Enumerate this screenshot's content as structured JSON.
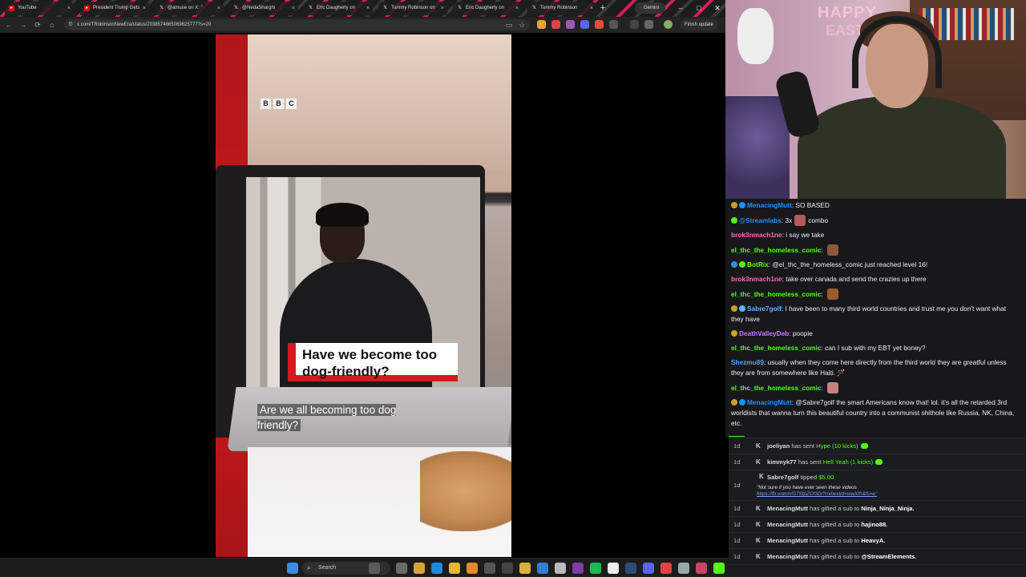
{
  "browser": {
    "tabs": [
      {
        "label": "YouTube",
        "icon": "youtube-icon",
        "color": "#ff0000"
      },
      {
        "label": "President Trump Gets",
        "icon": "youtube-icon",
        "color": "#ff0000"
      },
      {
        "label": "@amuse on X: \"",
        "icon": "x-icon",
        "color": "#ffffff"
      },
      {
        "label": "@NedaSharghi",
        "icon": "x-icon",
        "color": "#ffffff"
      },
      {
        "label": "Eric Daugherty on",
        "icon": "x-icon",
        "color": "#ffffff"
      },
      {
        "label": "Tommy Robinson on",
        "icon": "x-icon",
        "color": "#ffffff"
      },
      {
        "label": "Eric Daugherty on",
        "icon": "x-icon",
        "color": "#ffffff"
      },
      {
        "label": "Tommy Robinson",
        "icon": "x-icon",
        "color": "#ffffff"
      }
    ],
    "new_tab": "+",
    "gemini_label": "Gemini",
    "url": "x.com/TRobinsonNewEra/status/2038574665069625777?s=20",
    "finish_update": "Finish update",
    "window_controls": {
      "minimize": "–",
      "maximize": "□",
      "close": "✕"
    }
  },
  "video": {
    "logo": [
      "B",
      "B",
      "C"
    ],
    "headline": "Have we become too dog-friendly?",
    "subtitle": "Are we all becoming too dog friendly?"
  },
  "chat": {
    "messages": [
      {
        "user": "MenacingMutt",
        "user_color": "#1e90ff",
        "text": "SO BASED",
        "badges": [
          "#c9a227",
          "#1e90ff"
        ]
      },
      {
        "user": "@Streamlabs",
        "user_color": "#1e90ff",
        "text": "3x",
        "text2": "combo",
        "badges": [
          "#53fc18"
        ],
        "emote": "#b55a5a"
      },
      {
        "user": "brok3nmach1ne",
        "user_color": "#ff69b4",
        "text": "i say we take"
      },
      {
        "user": "el_thc_the_homeless_comic",
        "user_color": "#53fc18",
        "text": "",
        "emote": "#8a5a3c"
      },
      {
        "user": "BotRix",
        "user_color": "#53fc18",
        "text": "@el_thc_the_homeless_comic just reached level 16!",
        "badges": [
          "#3a8dde",
          "#53fc18"
        ]
      },
      {
        "user": "brok3nmach1ne",
        "user_color": "#ff69b4",
        "text": "take over canada and send the crazies up there"
      },
      {
        "user": "el_thc_the_homeless_comic",
        "user_color": "#53fc18",
        "text": "",
        "emote": "#9a5a2c"
      },
      {
        "user": "Sabre7golf",
        "user_color": "#5fb3ff",
        "text": "I have been to many third world countries and trust me you don't want what they have",
        "badges": [
          "#c9a227",
          "#5fb3ff"
        ]
      },
      {
        "user": "DeathValleyDeb",
        "user_color": "#c77dff",
        "text": "poopie",
        "badges": [
          "#c9a227"
        ]
      },
      {
        "user": "el_thc_the_homeless_comic",
        "user_color": "#53fc18",
        "text": "can I sub with my EBT yet boney?"
      },
      {
        "user": "Shezmu89",
        "user_color": "#4aa3ff",
        "text": "usually when they come here directly from the third world they are greatful unless they are from somewhere like Haiti. 🪄"
      },
      {
        "user": "el_thc_the_homeless_comic",
        "user_color": "#53fc18",
        "text": "",
        "emote": "#c98080"
      },
      {
        "user": "MenacingMutt",
        "user_color": "#1e90ff",
        "text": "@Sabre7golf the smart Americans know that! lol. it's all the retarded 3rd worldists that wanna turn this beautiful country into a communist shithole like Russia, NK, China, etc.",
        "badges": [
          "#c9a227",
          "#1e90ff"
        ]
      }
    ]
  },
  "events": [
    {
      "time": "1d",
      "user": "joeliyan",
      "action": "has sent",
      "item": "Hype (10 kicks)",
      "kick_icon": true
    },
    {
      "time": "1d",
      "user": "kimmyk77",
      "action": "has sent",
      "item": "Hell Yeah (1 kicks)",
      "kick_icon": true
    },
    {
      "time": "1d",
      "user": "Sabre7golf",
      "action": "tipped",
      "item": "$5.00",
      "note": "\"Not sure if you have ever seen these videos",
      "link": "https://fb.watch/G7StpZOf3D/?mibextid=wwXIfr&fs=e\""
    },
    {
      "time": "1d",
      "user": "MenacingMutt",
      "action": "has gifted a sub to",
      "target": "Ninja_Ninja_Ninja."
    },
    {
      "time": "1d",
      "user": "MenacingMutt",
      "action": "has gifted a sub to",
      "target": "hajino88."
    },
    {
      "time": "1d",
      "user": "MenacingMutt",
      "action": "has gifted a sub to",
      "target": "HeavyA."
    },
    {
      "time": "1d",
      "user": "MenacingMutt",
      "action": "has gifted a sub to",
      "target": "@StreamElements."
    }
  ],
  "taskbar": {
    "search_placeholder": "Search",
    "icons": [
      "windows-start-icon",
      "search-icon",
      "widgets-icon",
      "task-view-icon",
      "file-explorer-icon",
      "edge-icon",
      "chrome-icon",
      "chrome-canary-icon",
      "obs-icon",
      "terminal-icon",
      "folder-icon",
      "vscode-icon",
      "github-icon",
      "slack-icon",
      "spotify-icon",
      "notion-icon",
      "steam-icon",
      "discord-icon",
      "maps-icon",
      "snipping-icon",
      "photos-icon",
      "kick-icon"
    ]
  },
  "colors": {
    "kick_green": "#53fc18",
    "bbc_red": "#d8191e",
    "chat_bg": "#18181b"
  }
}
